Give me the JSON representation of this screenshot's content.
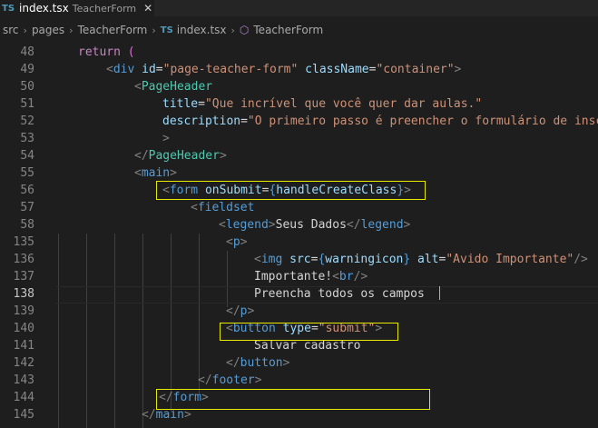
{
  "tab": {
    "lang": "TS",
    "filename": "index.tsx",
    "description": "TeacherForm",
    "close": "✕"
  },
  "breadcrumb": {
    "src": "src",
    "pages": "pages",
    "folder": "TeacherForm",
    "lang": "TS",
    "file": "index.tsx",
    "symbol": "TeacherForm"
  },
  "editor": {
    "current_line": "138",
    "lines": [
      {
        "n": "48",
        "tokens": [
          [
            "k",
            "return "
          ],
          [
            "br",
            "("
          ]
        ]
      },
      {
        "n": "49",
        "tokens": [
          [
            "p",
            "<"
          ],
          [
            "t",
            "div "
          ],
          [
            "a",
            "id"
          ],
          [
            "txt",
            "="
          ],
          [
            "s",
            "\"page-teacher-form\" "
          ],
          [
            "a",
            "className"
          ],
          [
            "txt",
            "="
          ],
          [
            "s",
            "\"container\""
          ],
          [
            "p",
            ">"
          ]
        ]
      },
      {
        "n": "50",
        "tokens": [
          [
            "p",
            "<"
          ],
          [
            "c",
            "PageHeader"
          ]
        ]
      },
      {
        "n": "51",
        "tokens": [
          [
            "a",
            "title"
          ],
          [
            "txt",
            "="
          ],
          [
            "s",
            "\"Que incrível que você quer dar aulas.\""
          ]
        ]
      },
      {
        "n": "52",
        "tokens": [
          [
            "a",
            "description"
          ],
          [
            "txt",
            "="
          ],
          [
            "s",
            "\"O primeiro passo é preencher o formulário de inscr"
          ]
        ]
      },
      {
        "n": "53",
        "tokens": [
          [
            "p",
            ">"
          ]
        ]
      },
      {
        "n": "54",
        "tokens": [
          [
            "p",
            "</"
          ],
          [
            "c",
            "PageHeader"
          ],
          [
            "p",
            ">"
          ]
        ]
      },
      {
        "n": "55",
        "tokens": [
          [
            "p",
            "<"
          ],
          [
            "t",
            "main"
          ],
          [
            "p",
            ">"
          ]
        ]
      },
      {
        "n": "56",
        "tokens": [
          [
            "p",
            "<"
          ],
          [
            "t",
            "form "
          ],
          [
            "a",
            "onSubmit"
          ],
          [
            "txt",
            "="
          ],
          [
            "t",
            "{"
          ],
          [
            "v",
            "handleCreateClass"
          ],
          [
            "t",
            "}"
          ],
          [
            "p",
            ">"
          ]
        ]
      },
      {
        "n": "57",
        "tokens": [
          [
            "p",
            "<"
          ],
          [
            "t",
            "fieldset"
          ]
        ]
      },
      {
        "n": "58",
        "tokens": [
          [
            "p",
            "<"
          ],
          [
            "t",
            "legend"
          ],
          [
            "p",
            ">"
          ],
          [
            "txt",
            "Seus Dados"
          ],
          [
            "p",
            "</"
          ],
          [
            "t",
            "legend"
          ],
          [
            "p",
            ">"
          ]
        ]
      },
      {
        "n": "135",
        "tokens": [
          [
            "p",
            "<"
          ],
          [
            "t",
            "p"
          ],
          [
            "p",
            ">"
          ]
        ]
      },
      {
        "n": "136",
        "tokens": [
          [
            "p",
            "<"
          ],
          [
            "t",
            "img "
          ],
          [
            "a",
            "src"
          ],
          [
            "txt",
            "="
          ],
          [
            "t",
            "{"
          ],
          [
            "v",
            "warningicon"
          ],
          [
            "t",
            "} "
          ],
          [
            "a",
            "alt"
          ],
          [
            "txt",
            "="
          ],
          [
            "s",
            "\"Avido Importante\""
          ],
          [
            "p",
            "/>"
          ]
        ]
      },
      {
        "n": "137",
        "tokens": [
          [
            "txt",
            "Importante!"
          ],
          [
            "p",
            "<"
          ],
          [
            "t",
            "br"
          ],
          [
            "p",
            "/>"
          ]
        ]
      },
      {
        "n": "138",
        "tokens": [
          [
            "txt",
            "Preencha todos os campos  "
          ]
        ]
      },
      {
        "n": "139",
        "tokens": [
          [
            "p",
            "</"
          ],
          [
            "t",
            "p"
          ],
          [
            "p",
            ">"
          ]
        ]
      },
      {
        "n": "140",
        "tokens": [
          [
            "p",
            "<"
          ],
          [
            "t",
            "button "
          ],
          [
            "a",
            "type"
          ],
          [
            "txt",
            "="
          ],
          [
            "s",
            "\"submit\""
          ],
          [
            "p",
            ">"
          ]
        ]
      },
      {
        "n": "141",
        "tokens": [
          [
            "txt",
            "Salvar cadastro"
          ]
        ]
      },
      {
        "n": "142",
        "tokens": [
          [
            "p",
            "</"
          ],
          [
            "t",
            "button"
          ],
          [
            "p",
            ">"
          ]
        ]
      },
      {
        "n": "143",
        "tokens": [
          [
            "p",
            "</"
          ],
          [
            "t",
            "footer"
          ],
          [
            "p",
            ">"
          ]
        ]
      },
      {
        "n": "144",
        "tokens": [
          [
            "p",
            "</"
          ],
          [
            "t",
            "form"
          ],
          [
            "p",
            ">"
          ]
        ]
      },
      {
        "n": "145",
        "tokens": [
          [
            "p",
            "</"
          ],
          [
            "t",
            "main"
          ],
          [
            "p",
            ">"
          ]
        ]
      }
    ]
  },
  "colors": {
    "background": "#1e1e1e",
    "keyword": "#c586c0",
    "tag": "#569cd6",
    "component": "#4ec9b0",
    "attribute": "#9cdcfe",
    "string": "#ce9178",
    "highlight_box": "#e8e800"
  }
}
